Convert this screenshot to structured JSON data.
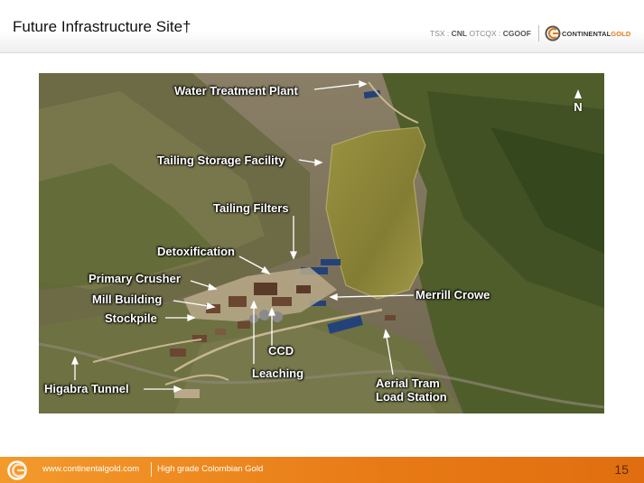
{
  "header": {
    "title": "Future Infrastructure Site†",
    "tickers": {
      "tsx_label": "TSX : ",
      "tsx_symbol": "CNL",
      "otc_label": "  OTCQX : ",
      "otc_symbol": "CGOOF"
    },
    "logo": {
      "word1": "CONTINENTAL",
      "word2": "GOLD"
    }
  },
  "map": {
    "north_label": "N",
    "labels": {
      "water_treatment_plant": "Water Treatment Plant",
      "tailing_storage_facility": "Tailing Storage Facility",
      "tailing_filters": "Tailing Filters",
      "detoxification": "Detoxification",
      "primary_crusher": "Primary Crusher",
      "mill_building": "Mill Building",
      "stockpile": "Stockpile",
      "merrill_crowe": "Merrill Crowe",
      "ccd": "CCD",
      "leaching": "Leaching",
      "aerial_tram": "Aerial Tram",
      "load_station": "Load Station",
      "higabra_tunnel": "Higabra Tunnel"
    }
  },
  "footer": {
    "url": "www.continentalgold.com",
    "tagline": "High grade Colombian Gold",
    "page_number": "15"
  },
  "colors": {
    "accent_orange": "#e87a15",
    "terrain_green": "#5f6a35",
    "tailings_olive": "#8f8a35",
    "pond_blue": "#24427a"
  }
}
